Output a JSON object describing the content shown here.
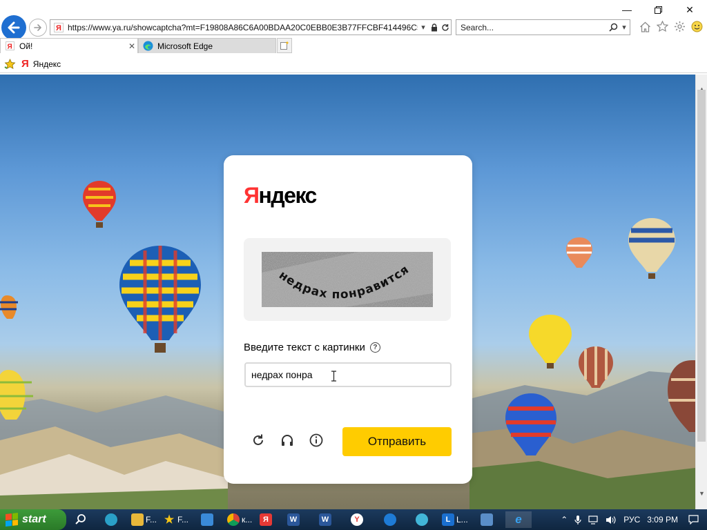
{
  "browser": {
    "url": "https://www.ya.ru/showcaptcha?mt=F19808A86C6A00BDAA20C0EBB0E3B77FFCBF414496C502C",
    "search_placeholder": "Search...",
    "tabs": [
      {
        "label": "Ой!",
        "active": true
      },
      {
        "label": "Microsoft Edge",
        "active": false
      }
    ],
    "favorites": [
      {
        "label": "Яндекс"
      }
    ]
  },
  "captcha": {
    "logo_red": "Я",
    "logo_rest": "ндекс",
    "image_text": "недрах понравится",
    "prompt_label": "Введите текст с картинки",
    "help_glyph": "?",
    "input_value": "недрах понра",
    "submit_label": "Отправить"
  },
  "taskbar": {
    "start_label": "start",
    "items": [
      "F...",
      "F...",
      "к...",
      "L..."
    ],
    "lang": "РУС",
    "time": "3:09 PM"
  },
  "colors": {
    "accent_yellow": "#ffcc00",
    "yandex_red": "#ff3333",
    "ie_blue": "#1f6fd1"
  }
}
